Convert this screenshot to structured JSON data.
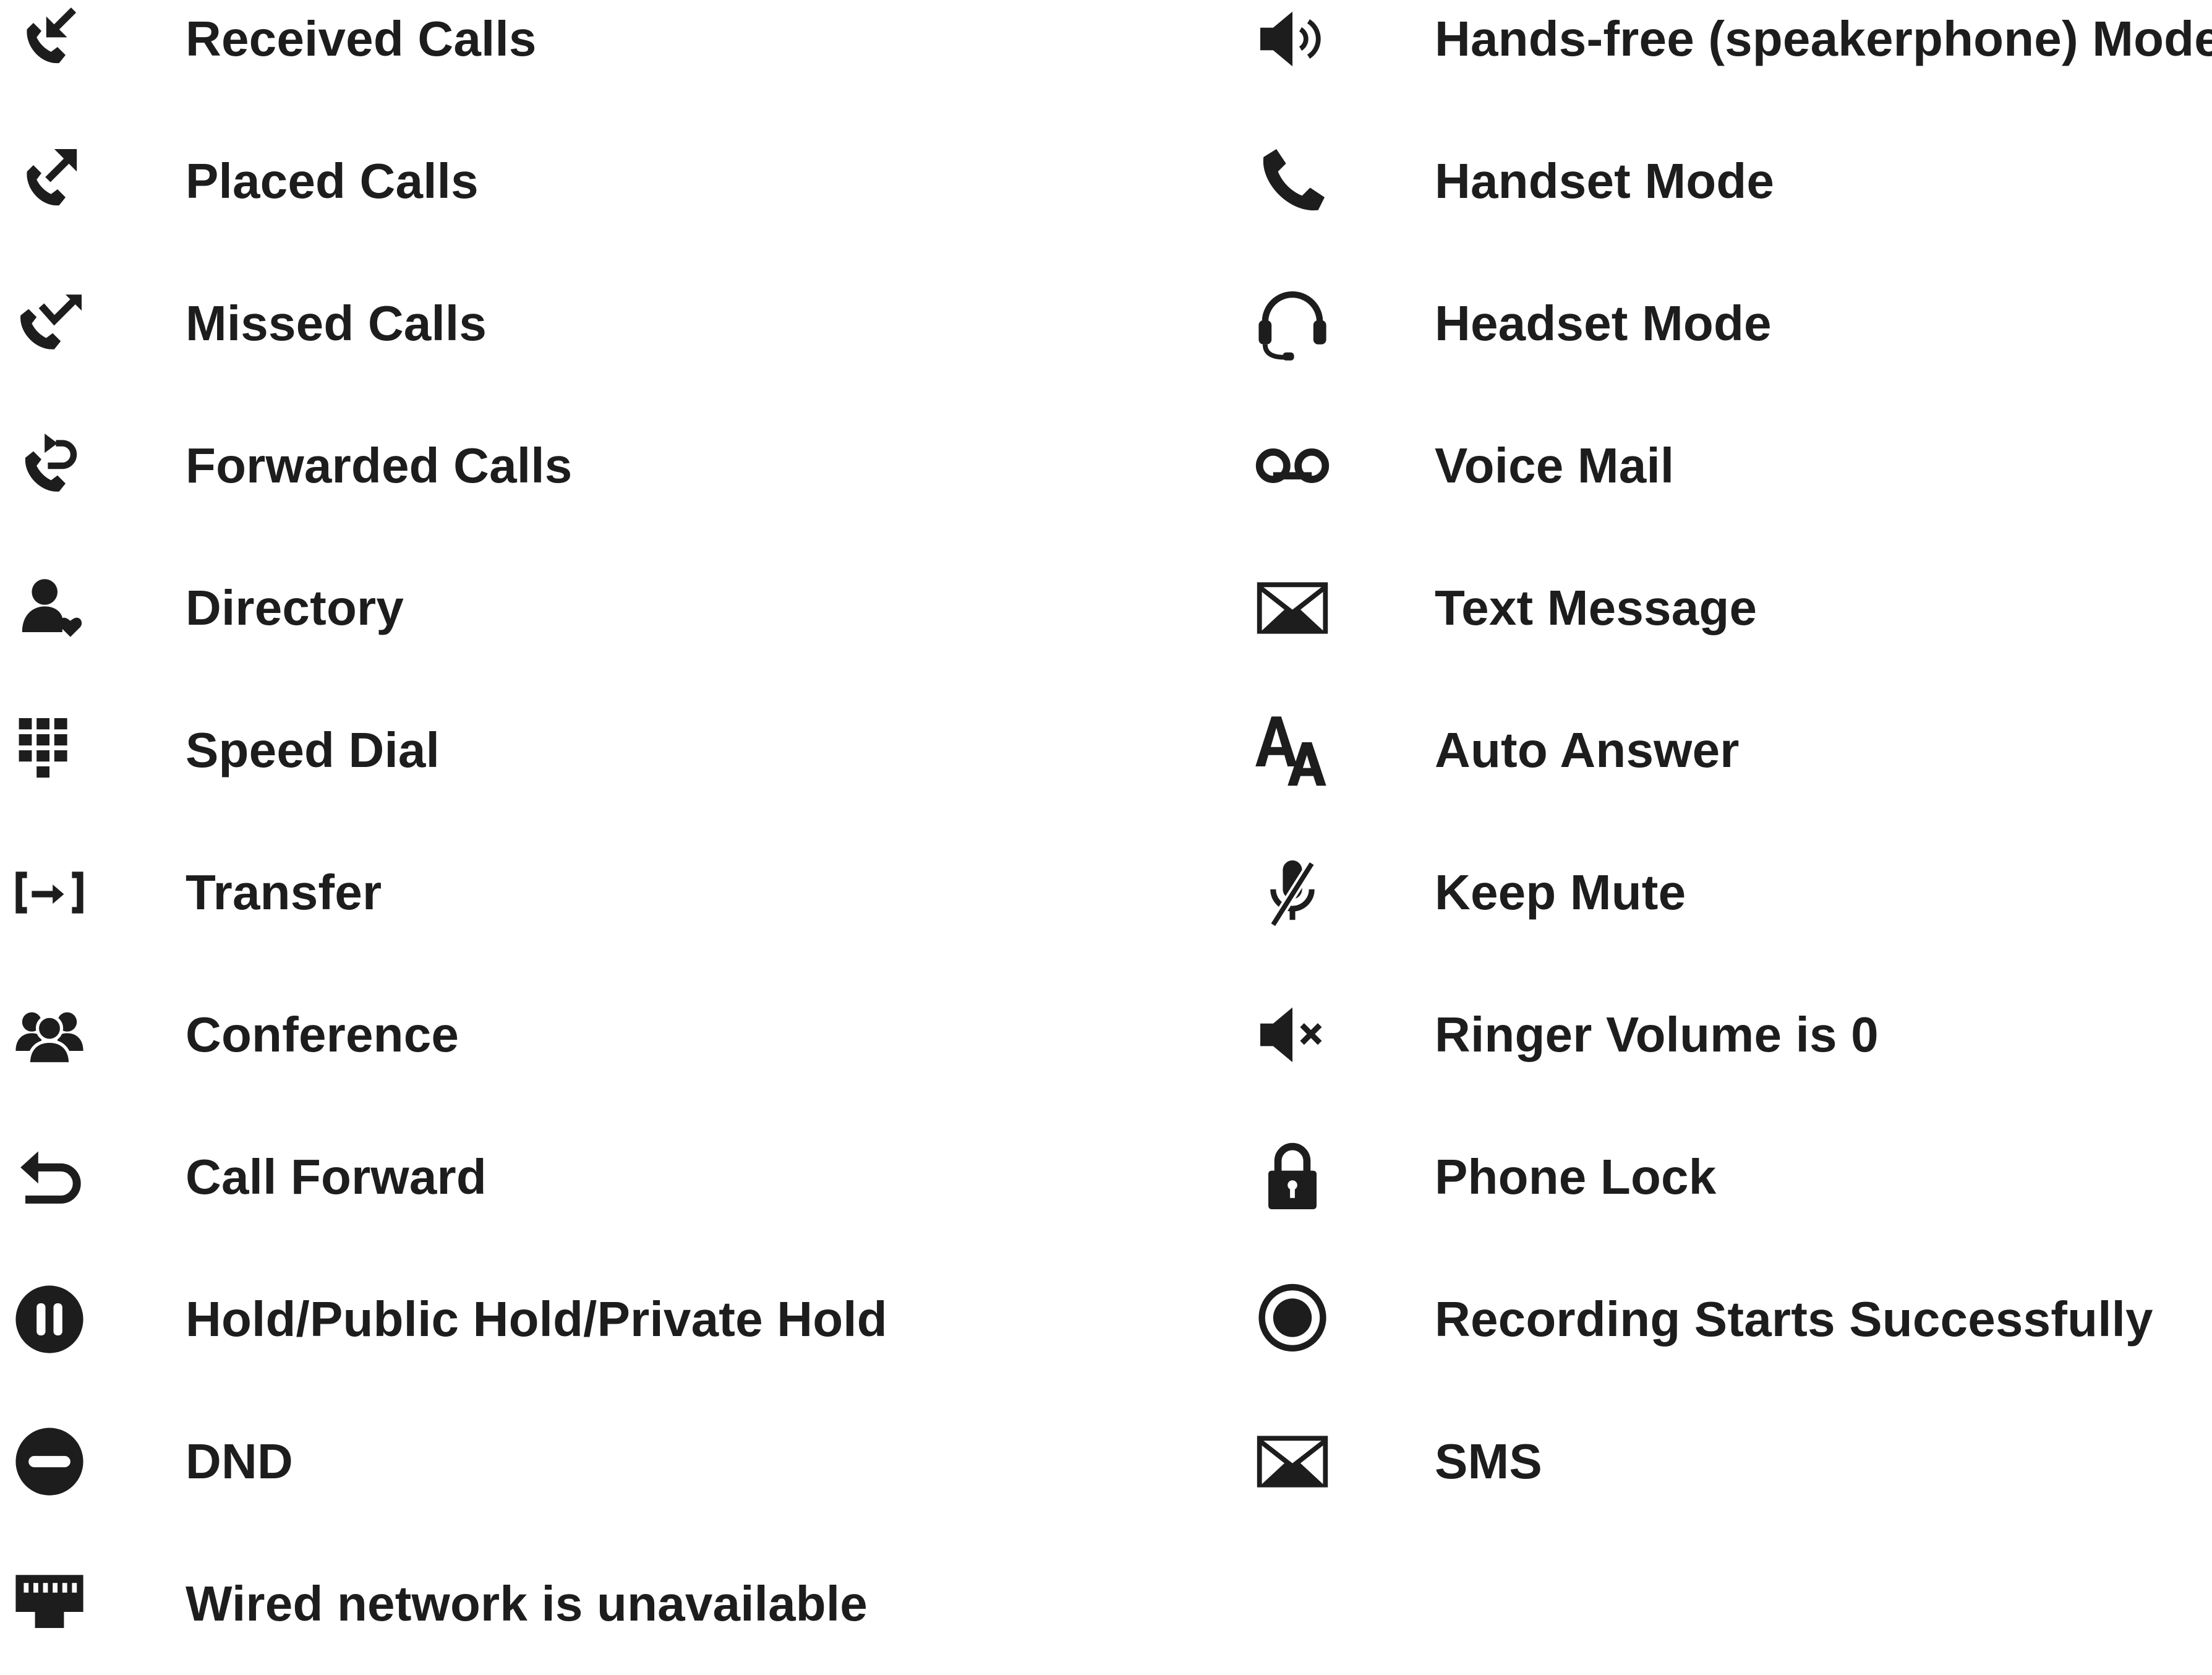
{
  "ink_color": "#1d1d1d",
  "left_column": [
    {
      "icon": "received-calls-icon",
      "label": "Received Calls"
    },
    {
      "icon": "placed-calls-icon",
      "label": "Placed Calls"
    },
    {
      "icon": "missed-calls-icon",
      "label": "Missed Calls"
    },
    {
      "icon": "forwarded-calls-icon",
      "label": "Forwarded Calls"
    },
    {
      "icon": "directory-icon",
      "label": "Directory"
    },
    {
      "icon": "speed-dial-icon",
      "label": "Speed Dial"
    },
    {
      "icon": "transfer-icon",
      "label": "Transfer"
    },
    {
      "icon": "conference-icon",
      "label": "Conference"
    },
    {
      "icon": "call-forward-icon",
      "label": "Call Forward"
    },
    {
      "icon": "hold-icon",
      "label": "Hold/Public Hold/Private Hold"
    },
    {
      "icon": "dnd-icon",
      "label": "DND"
    },
    {
      "icon": "wired-network-unavailable-icon",
      "label": "Wired network is unavailable"
    }
  ],
  "right_column": [
    {
      "icon": "speakerphone-icon",
      "label": "Hands-free (speakerphone) Mode"
    },
    {
      "icon": "handset-icon",
      "label": "Handset Mode"
    },
    {
      "icon": "headset-icon",
      "label": "Headset Mode"
    },
    {
      "icon": "voice-mail-icon",
      "label": "Voice Mail"
    },
    {
      "icon": "envelope-icon",
      "label": "Text Message"
    },
    {
      "icon": "auto-answer-icon",
      "label": "Auto Answer"
    },
    {
      "icon": "keep-mute-icon",
      "label": "Keep Mute"
    },
    {
      "icon": "ringer-muted-icon",
      "label": "Ringer Volume is 0"
    },
    {
      "icon": "lock-icon",
      "label": "Phone Lock"
    },
    {
      "icon": "recording-icon",
      "label": "Recording Starts Successfully"
    },
    {
      "icon": "sms-envelope-icon",
      "label": "SMS"
    }
  ]
}
